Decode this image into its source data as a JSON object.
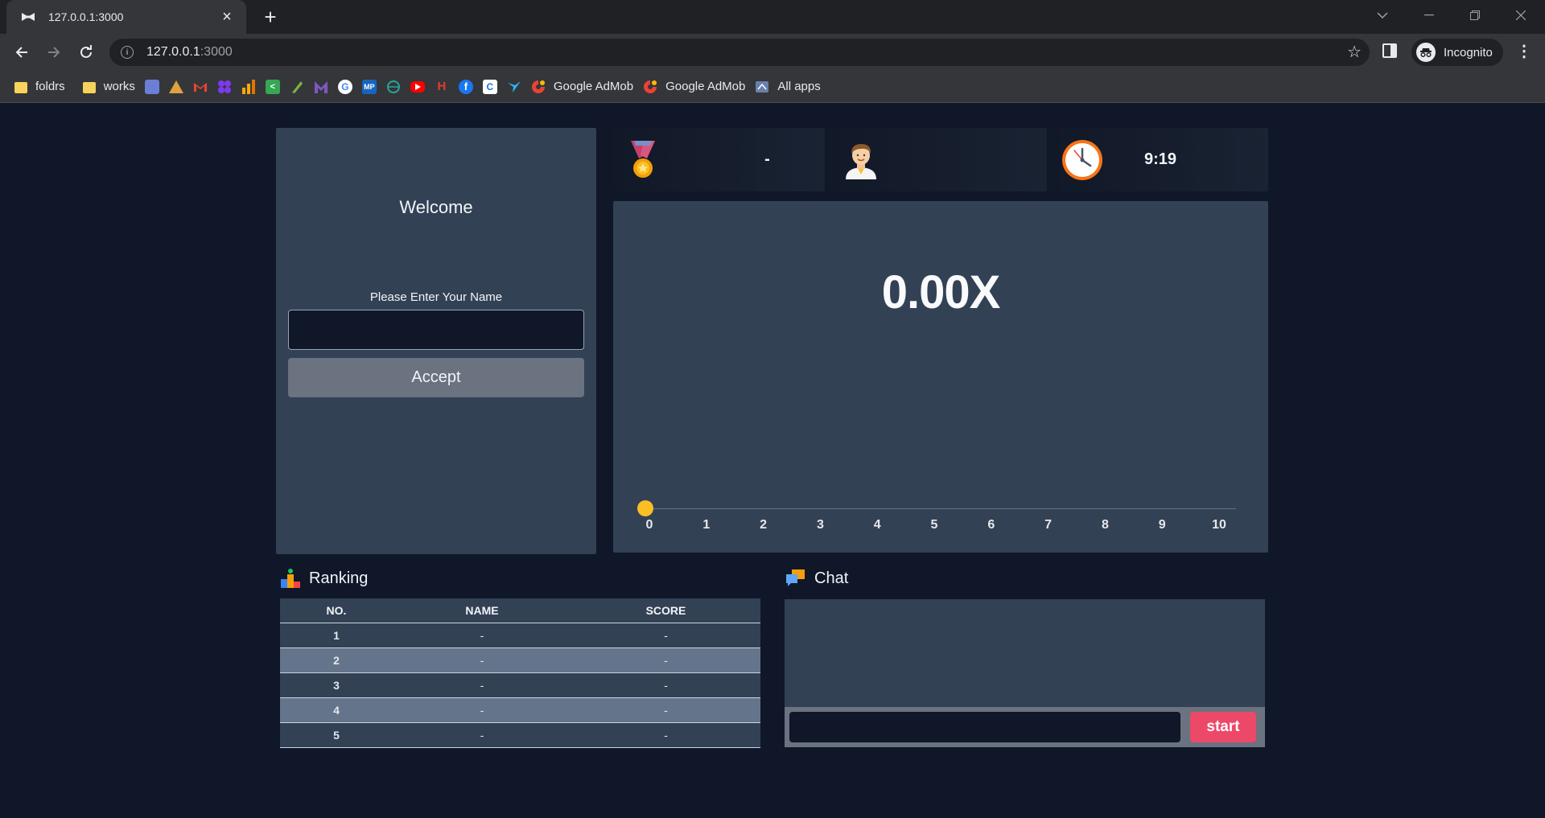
{
  "browser": {
    "tab_title": "127.0.0.1:3000",
    "url_host": "127.0.0.1",
    "url_port": ":3000",
    "profile_label": "Incognito",
    "bookmarks": [
      {
        "label": "foldrs",
        "icon": "folder-icon"
      },
      {
        "label": "works",
        "icon": "folder-icon"
      },
      {
        "label": "Google AdMob",
        "icon": "admob-icon"
      },
      {
        "label": "Google AdMob",
        "icon": "admob-icon"
      },
      {
        "label": "All apps",
        "icon": "apps-icon"
      }
    ]
  },
  "welcome": {
    "title": "Welcome",
    "name_label": "Please Enter Your Name",
    "name_value": "",
    "accept_label": "Accept"
  },
  "stats": {
    "medal_value": "-",
    "player_value": "",
    "timer_value": "9:19"
  },
  "game": {
    "multiplier": "0.00X",
    "progress": 0,
    "axis_ticks": [
      "0",
      "1",
      "2",
      "3",
      "4",
      "5",
      "6",
      "7",
      "8",
      "9",
      "10"
    ]
  },
  "ranking": {
    "title": "Ranking",
    "headers": {
      "no": "NO.",
      "name": "NAME",
      "score": "SCORE"
    },
    "rows": [
      {
        "no": "1",
        "name": "-",
        "score": "-"
      },
      {
        "no": "2",
        "name": "-",
        "score": "-"
      },
      {
        "no": "3",
        "name": "-",
        "score": "-"
      },
      {
        "no": "4",
        "name": "-",
        "score": "-"
      },
      {
        "no": "5",
        "name": "-",
        "score": "-"
      }
    ]
  },
  "chat": {
    "title": "Chat",
    "input_value": "",
    "send_label": "start"
  },
  "colors": {
    "page_bg": "#0f1729",
    "panel": "#334155",
    "accent_pink": "#ec4868",
    "marker_yellow": "#fbbf24"
  }
}
